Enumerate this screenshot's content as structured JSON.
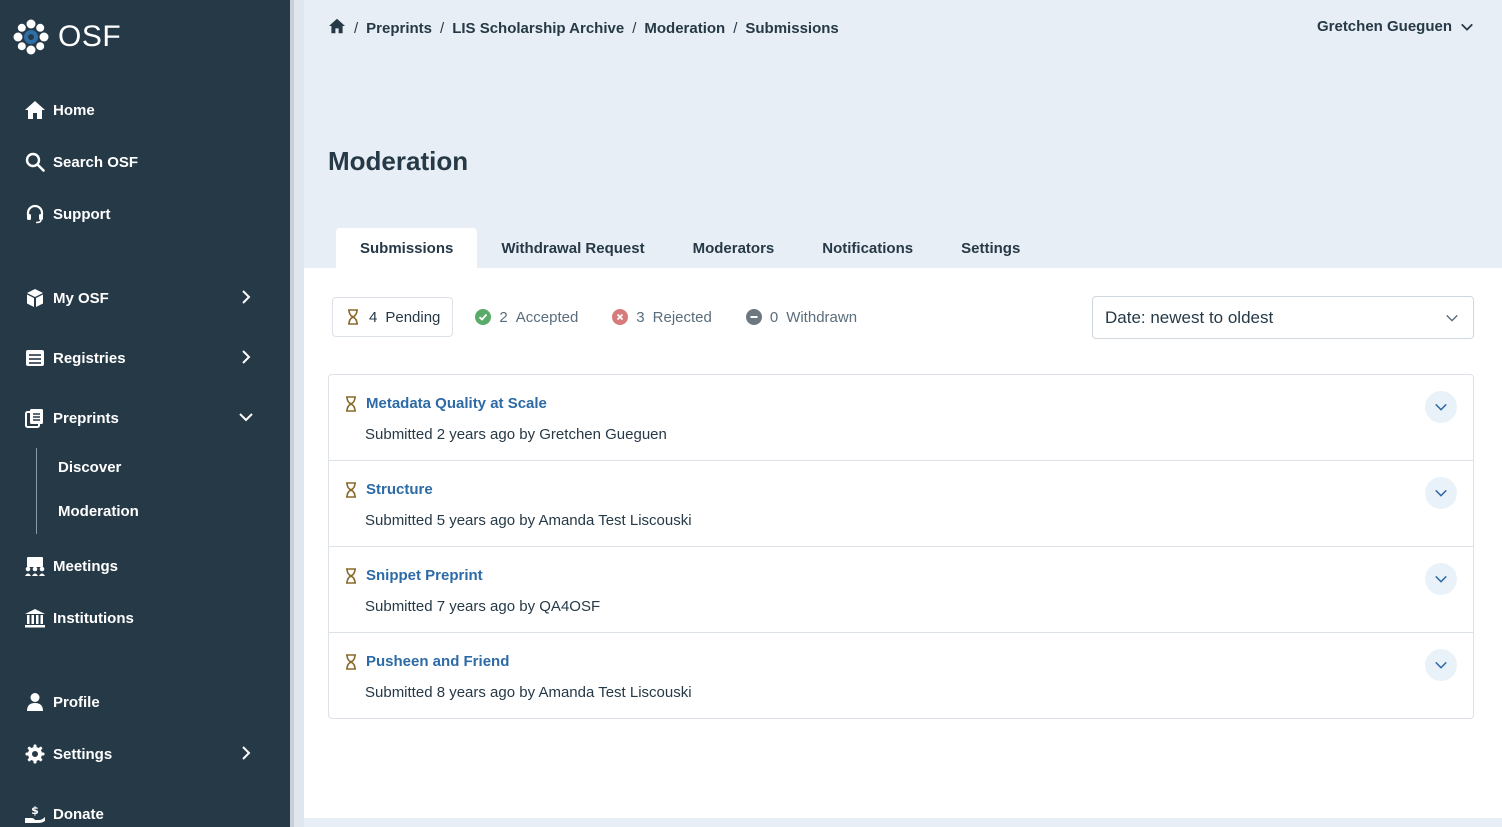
{
  "sidebar": {
    "logo_text": "OSF",
    "items": [
      {
        "label": "Home",
        "icon": "home-icon"
      },
      {
        "label": "Search OSF",
        "icon": "search-icon"
      },
      {
        "label": "Support",
        "icon": "headset-icon"
      },
      {
        "label": "My OSF",
        "icon": "cube-icon"
      },
      {
        "label": "Registries",
        "icon": "registries-icon"
      },
      {
        "label": "Preprints",
        "icon": "preprints-icon"
      },
      {
        "label": "Meetings",
        "icon": "meetings-icon"
      },
      {
        "label": "Institutions",
        "icon": "institution-icon"
      },
      {
        "label": "Profile",
        "icon": "user-icon"
      },
      {
        "label": "Settings",
        "icon": "gear-icon"
      },
      {
        "label": "Donate",
        "icon": "donate-icon"
      }
    ],
    "preprints_sub": [
      "Discover",
      "Moderation"
    ]
  },
  "header": {
    "breadcrumb": [
      "Preprints",
      "LIS Scholarship Archive",
      "Moderation",
      "Submissions"
    ],
    "user_name": "Gretchen Gueguen"
  },
  "page_title": "Moderation",
  "tabs": [
    "Submissions",
    "Withdrawal Request",
    "Moderators",
    "Notifications",
    "Settings"
  ],
  "filters": [
    {
      "count": "4",
      "label": "Pending"
    },
    {
      "count": "2",
      "label": "Accepted"
    },
    {
      "count": "3",
      "label": "Rejected"
    },
    {
      "count": "0",
      "label": "Withdrawn"
    }
  ],
  "sort": {
    "selected": "Date: newest to oldest"
  },
  "submissions": [
    {
      "title": "Metadata Quality at Scale",
      "meta": "Submitted 2 years ago by Gretchen Gueguen"
    },
    {
      "title": "Structure",
      "meta": "Submitted 5 years ago by Amanda Test Liscouski"
    },
    {
      "title": "Snippet Preprint",
      "meta": "Submitted 7 years ago by QA4OSF"
    },
    {
      "title": "Pusheen and Friend",
      "meta": "Submitted 8 years ago by Amanda Test Liscouski"
    }
  ],
  "colors": {
    "sidebar_bg": "#263947",
    "link": "#2d6ba6",
    "pending": "#8a6a2b",
    "accepted": "#5aab6a",
    "rejected": "#d67a7a",
    "withdrawn": "#6d7780"
  }
}
